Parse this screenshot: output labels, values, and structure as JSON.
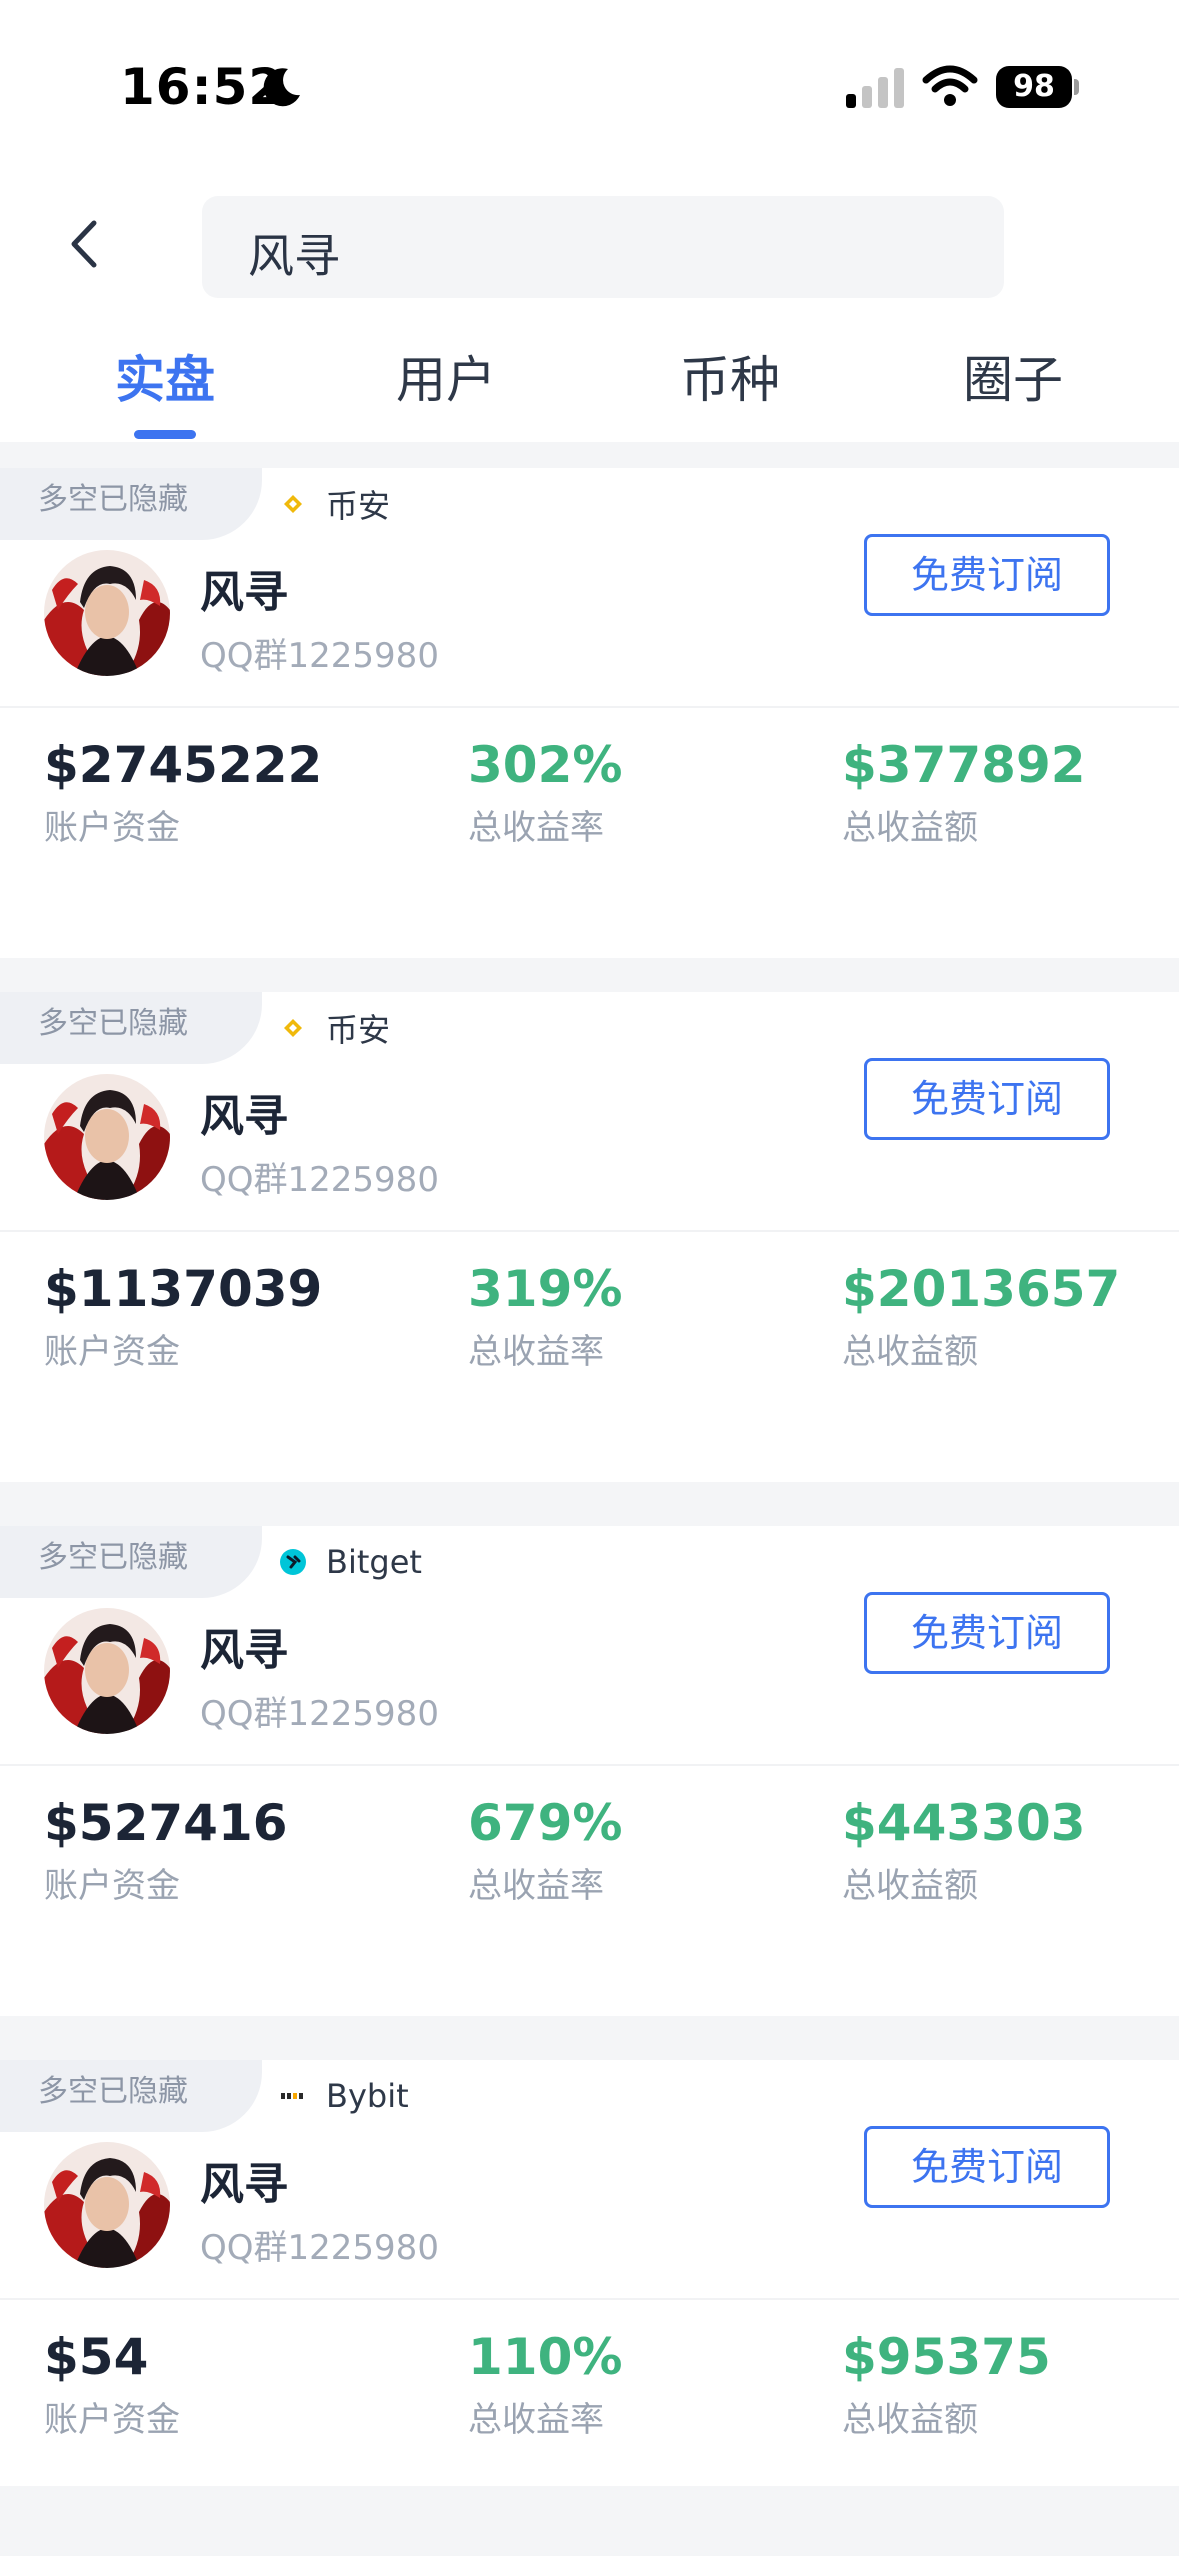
{
  "status_bar": {
    "time": "16:52",
    "battery": "98"
  },
  "search": {
    "query": "风寻"
  },
  "tabs": [
    {
      "label": "实盘",
      "active": true
    },
    {
      "label": "用户",
      "active": false
    },
    {
      "label": "币种",
      "active": false
    },
    {
      "label": "圈子",
      "active": false
    }
  ],
  "cards": [
    {
      "tag": "多空已隐藏",
      "exchange": "币安",
      "exchange_icon": "binance-icon",
      "name": "风寻",
      "subtitle": "QQ群1225980",
      "button": "免费订阅",
      "account_value": "$2745222",
      "account_label": "账户资金",
      "roi": "302%",
      "roi_label": "总收益率",
      "profit": "$377892",
      "profit_label": "总收益额"
    },
    {
      "tag": "多空已隐藏",
      "exchange": "币安",
      "exchange_icon": "binance-icon",
      "name": "风寻",
      "subtitle": "QQ群1225980",
      "button": "免费订阅",
      "account_value": "$1137039",
      "account_label": "账户资金",
      "roi": "319%",
      "roi_label": "总收益率",
      "profit": "$2013657",
      "profit_label": "总收益额"
    },
    {
      "tag": "多空已隐藏",
      "exchange": "Bitget",
      "exchange_icon": "bitget-icon",
      "name": "风寻",
      "subtitle": "QQ群1225980",
      "button": "免费订阅",
      "account_value": "$527416",
      "account_label": "账户资金",
      "roi": "679%",
      "roi_label": "总收益率",
      "profit": "$443303",
      "profit_label": "总收益额"
    },
    {
      "tag": "多空已隐藏",
      "exchange": "Bybit",
      "exchange_icon": "bybit-icon",
      "name": "风寻",
      "subtitle": "QQ群1225980",
      "button": "免费订阅",
      "account_value": "$54",
      "account_label": "账户资金",
      "roi": "110%",
      "roi_label": "总收益率",
      "profit": "$95375",
      "profit_label": "总收益额"
    }
  ],
  "colors": {
    "accent": "#3d74f0",
    "positive": "#3fb37f",
    "binance": "#f0b90b",
    "bitget": "#00c5d8"
  }
}
